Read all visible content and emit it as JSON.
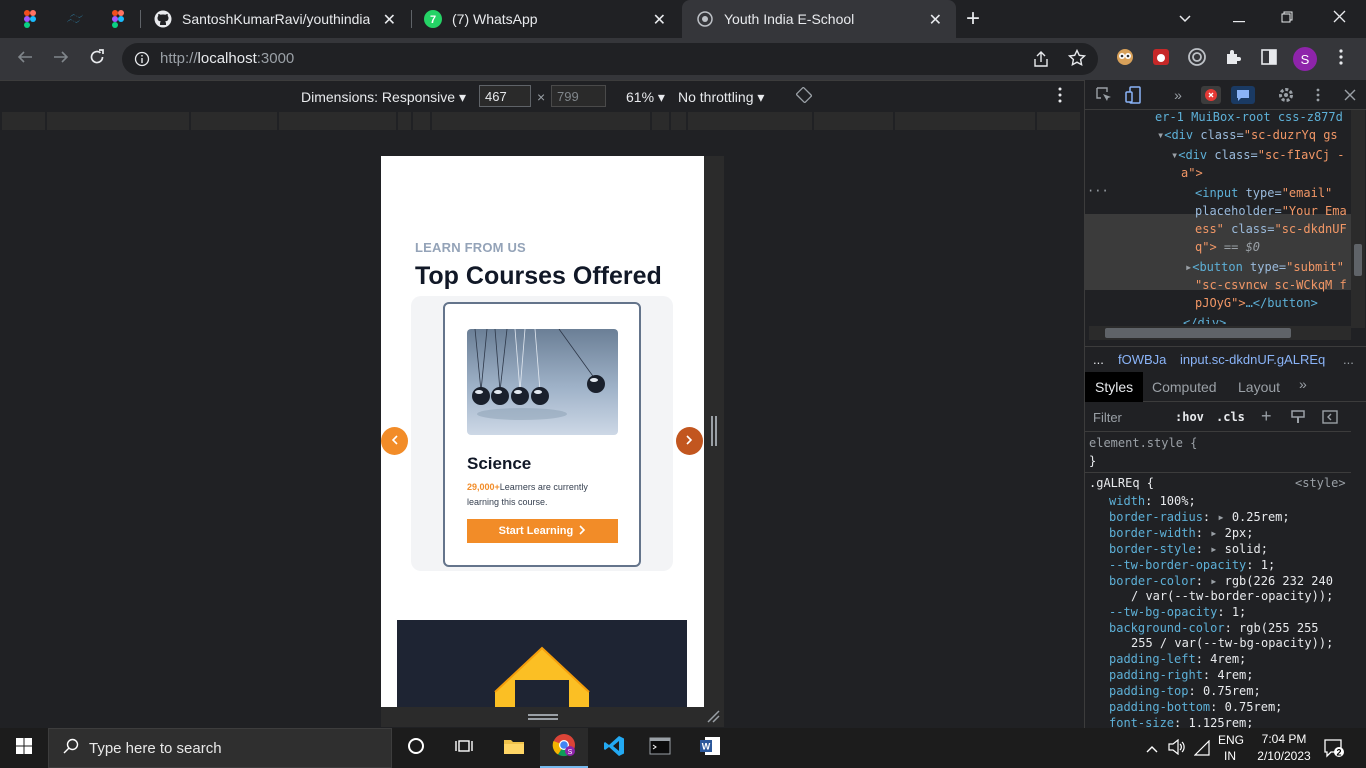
{
  "browser": {
    "tabs": [
      {
        "title": "",
        "icon": "figma-icon"
      },
      {
        "title": "",
        "icon": "tailwind-icon"
      },
      {
        "title": "",
        "icon": "figma-icon"
      },
      {
        "title": "SantoshKumarRavi/youthindiaesc",
        "icon": "github-icon"
      },
      {
        "title": "(7) WhatsApp",
        "icon": "whatsapp-icon",
        "badge": "7"
      },
      {
        "title": "Youth India E-School",
        "icon": "globe-icon",
        "active": true
      }
    ],
    "new_tab": "+",
    "url_scheme": "http://",
    "url_host": "localhost",
    "url_rest": ":3000",
    "profile_initial": "S"
  },
  "device_toolbar": {
    "dimensions_label": "Dimensions: Responsive",
    "width": "467",
    "height": "799",
    "times": "×",
    "zoom": "61%",
    "throttling": "No throttling"
  },
  "page": {
    "kicker": "LEARN FROM US",
    "heading": "Top Courses Offered",
    "course": {
      "title": "Science",
      "learners": "29,000+",
      "desc": "Learners are currently learning this course.",
      "button": "Start Learning"
    },
    "prev": "‹",
    "next": "›"
  },
  "devtools": {
    "dom_lines": [
      {
        "a": "er-1 MuiBox-root css-z877d"
      },
      {
        "a": "<div ",
        "b": "class=",
        "c": "\"sc-duzrYq gs"
      },
      {
        "a": "<div ",
        "b": "class=",
        "c": "\"sc-fIavCj -"
      },
      {
        "a": "a\">"
      },
      {
        "a": "<input ",
        "b": "type=",
        "c": "\"email\""
      },
      {
        "a": "",
        "b": "placeholder=",
        "c": "\"Your Ema"
      },
      {
        "a": "",
        "c": "ess\" ",
        "b": "class=",
        "d": "\"sc-dkdnUF"
      },
      {
        "c": "q\">",
        "e": " == $0"
      },
      {
        "a": "<button ",
        "b": "type=",
        "c": "\"submit\""
      },
      {
        "c": "\"sc-csvncw sc-WCkqM f"
      },
      {
        "c": "pJOyG\">",
        "a": "…</button>"
      },
      {
        "a": "</div>"
      }
    ],
    "breadcrumb": [
      "...",
      "fOWBJa",
      "input.sc-dkdnUF.gALREq",
      "..."
    ],
    "panel_tabs": [
      "Styles",
      "Computed",
      "Layout",
      "»"
    ],
    "filter_placeholder": "Filter",
    "hov": ":hov",
    "cls": ".cls",
    "element_style": "element.style {",
    "close_brace": "}",
    "rule_selector": ".gALREq {",
    "rule_source": "<style>",
    "props": [
      {
        "name": "width",
        "value": "100%;"
      },
      {
        "name": "border-radius",
        "value": "0.25rem;",
        "tri": true
      },
      {
        "name": "border-width",
        "value": "2px;",
        "tri": true
      },
      {
        "name": "border-style",
        "value": "solid;",
        "tri": true
      },
      {
        "name": "--tw-border-opacity",
        "value": "1;"
      },
      {
        "name": "border-color",
        "value": "rgb(226 232 240",
        "tri": true,
        "cont": "/ var(--tw-border-opacity));"
      },
      {
        "name": "--tw-bg-opacity",
        "value": "1;"
      },
      {
        "name": "background-color",
        "value": "rgb(255 255",
        "cont": "255 / var(--tw-bg-opacity));"
      },
      {
        "name": "padding-left",
        "value": "4rem;"
      },
      {
        "name": "padding-right",
        "value": "4rem;"
      },
      {
        "name": "padding-top",
        "value": "0.75rem;"
      },
      {
        "name": "padding-bottom",
        "value": "0.75rem;"
      },
      {
        "name": "font-size",
        "value": "1.125rem;"
      }
    ]
  },
  "taskbar": {
    "search_placeholder": "Type here to search",
    "lang_top": "ENG",
    "lang_bottom": "IN",
    "time": "7:04 PM",
    "date": "2/10/2023",
    "notifications": "2"
  },
  "colors": {
    "accent_orange": "#f28c28",
    "arrow_dark": "#c2561f",
    "profile_purple": "#8e24aa"
  }
}
